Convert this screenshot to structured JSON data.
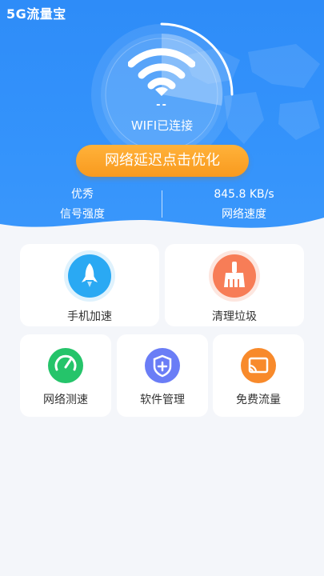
{
  "app": {
    "title": "5G流量宝"
  },
  "hero": {
    "speed_placeholder": "--",
    "wifi_status": "WIFI已连接",
    "optimize_button": "网络延迟点击优化",
    "signal": {
      "value": "优秀",
      "label": "信号强度"
    },
    "speed": {
      "value": "845.8 KB/s",
      "label": "网络速度"
    }
  },
  "tools": [
    {
      "label": "手机加速",
      "icon": "rocket-icon",
      "color": "#2aa9f3"
    },
    {
      "label": "清理垃圾",
      "icon": "broom-icon",
      "color": "#f77d57"
    },
    {
      "label": "网络测速",
      "icon": "speedometer-icon",
      "color": "#25c46a"
    },
    {
      "label": "软件管理",
      "icon": "shield-icon",
      "color": "#6a7df6"
    },
    {
      "label": "免费流量",
      "icon": "cast-icon",
      "color": "#f88a2b"
    }
  ],
  "colors": {
    "primary": "#2e8cf8",
    "accent": "#f99a1e",
    "background": "#f4f6fa"
  }
}
